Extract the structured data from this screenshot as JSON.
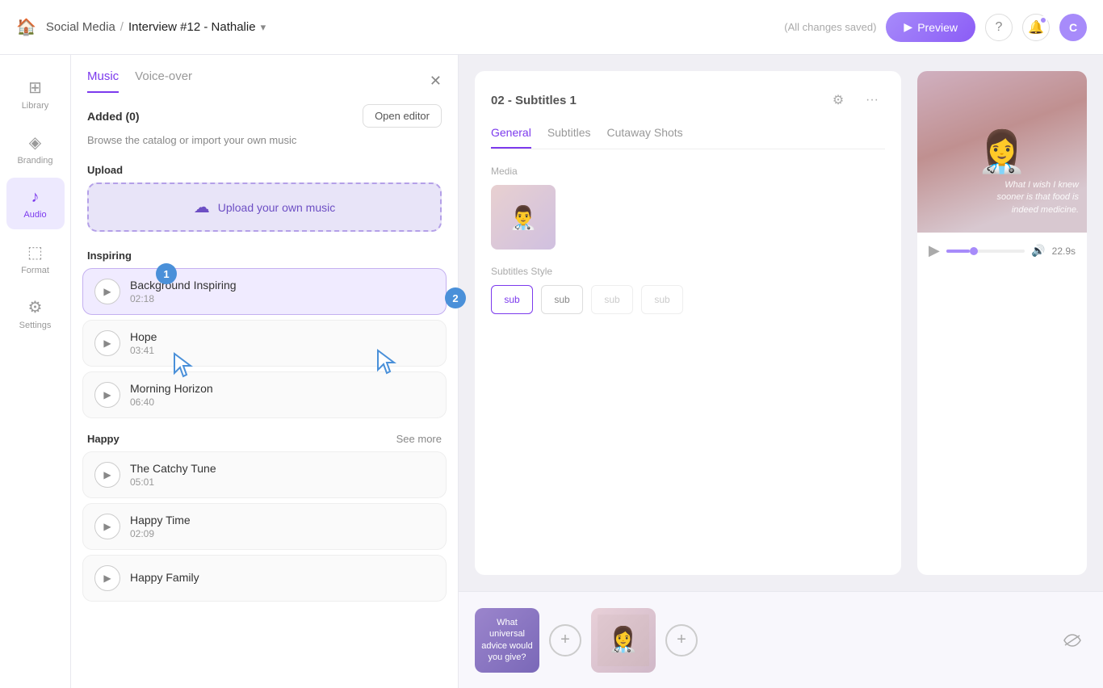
{
  "topbar": {
    "home_icon": "🏠",
    "breadcrumb_parent": "Social Media",
    "separator": "/",
    "breadcrumb_current": "Interview #12 - Nathalie",
    "chevron": "▾",
    "saved_text": "(All changes saved)",
    "preview_label": "Preview"
  },
  "sidebar": {
    "items": [
      {
        "id": "library",
        "label": "Library",
        "icon": "⊞"
      },
      {
        "id": "branding",
        "label": "Branding",
        "icon": "◈"
      },
      {
        "id": "audio",
        "label": "Audio",
        "icon": "♪"
      },
      {
        "id": "format",
        "label": "Format",
        "icon": "⬚"
      },
      {
        "id": "settings",
        "label": "Settings",
        "icon": "⚙"
      }
    ],
    "active": "audio"
  },
  "panel": {
    "tab_music": "Music",
    "tab_voiceover": "Voice-over",
    "added_label": "Added (0)",
    "open_editor_label": "Open editor",
    "browse_text": "Browse the catalog or import your own music",
    "upload_section_title": "Upload",
    "upload_button_label": "Upload your own music",
    "music_sections": [
      {
        "name": "Inspiring",
        "show_more": false,
        "tracks": [
          {
            "name": "Background Inspiring",
            "duration": "02:18"
          },
          {
            "name": "Hope",
            "duration": "03:41"
          },
          {
            "name": "Morning Horizon",
            "duration": "06:40"
          }
        ]
      },
      {
        "name": "Happy",
        "show_more": true,
        "see_more_label": "See more",
        "tracks": [
          {
            "name": "The Catchy Tune",
            "duration": "05:01"
          },
          {
            "name": "Happy Time",
            "duration": "02:09"
          },
          {
            "name": "Happy Family",
            "duration": "..."
          }
        ]
      }
    ]
  },
  "content": {
    "panel_title": "02 - Subtitles 1",
    "tabs": [
      "General",
      "Subtitles",
      "Cutaway Shots"
    ],
    "active_tab": "General",
    "media_label": "Media",
    "subtitle_style_label": "Subtitles Style",
    "subtitle_options": [
      "sub",
      "sub",
      "sub",
      "sub"
    ],
    "preview_overlay_text": "What I wish I knew sooner is that food is indeed medicine.",
    "preview_time": "22.9s"
  },
  "steps": {
    "badge_1": "1",
    "badge_2": "2"
  },
  "timeline": {
    "thumb1_text": "What universal advice would you give?",
    "add_icon": "+",
    "add2_icon": "+"
  }
}
